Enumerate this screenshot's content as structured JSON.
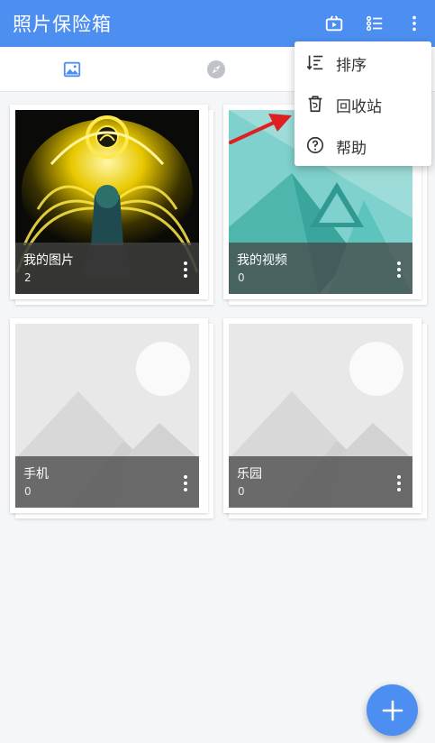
{
  "appbar": {
    "title": "照片保险箱",
    "actions": [
      {
        "icon": "play-box-icon"
      },
      {
        "icon": "list-view-icon"
      },
      {
        "icon": "more-vert-icon"
      }
    ]
  },
  "tabs": [
    {
      "icon": "image-icon",
      "active": true
    },
    {
      "icon": "compass-icon",
      "active": false
    }
  ],
  "albums": [
    {
      "name": "我的图片",
      "count": "2"
    },
    {
      "name": "我的视频",
      "count": "0"
    },
    {
      "name": "手机",
      "count": "0"
    },
    {
      "name": "乐园",
      "count": "0"
    }
  ],
  "menu": {
    "items": [
      {
        "label": "排序",
        "icon": "sort-icon"
      },
      {
        "label": "回收站",
        "icon": "trash-icon"
      },
      {
        "label": "帮助",
        "icon": "help-icon"
      }
    ]
  },
  "fab": {
    "icon": "add-icon"
  },
  "colors": {
    "primary": "#4d8ff0",
    "annotation_arrow": "#e02020"
  }
}
